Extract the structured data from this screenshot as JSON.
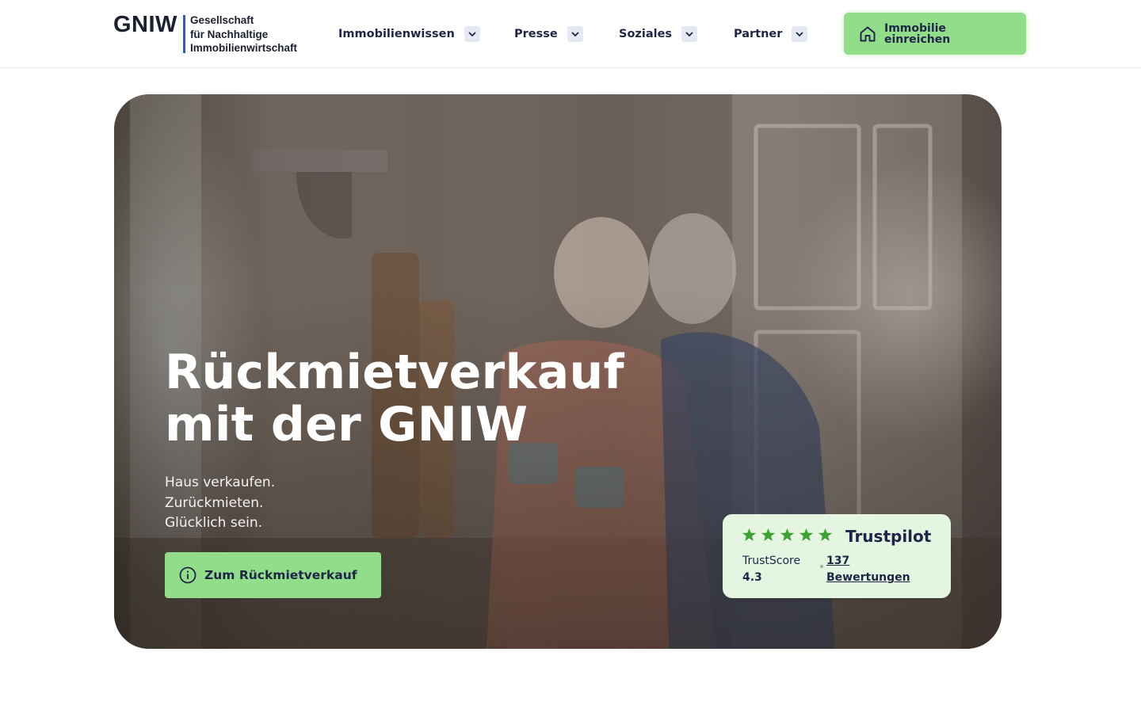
{
  "header": {
    "logo": {
      "mark": "GNIW",
      "line1": "Gesellschaft",
      "line2": "für Nachhaltige",
      "line3": "Immobilienwirtschaft"
    },
    "nav": [
      {
        "label": "Immobilienwissen"
      },
      {
        "label": "Presse"
      },
      {
        "label": "Soziales"
      },
      {
        "label": "Partner"
      }
    ],
    "cta": {
      "line1": "Immobilie",
      "line2": "einreichen",
      "icon": "home-icon"
    }
  },
  "hero": {
    "title_line1": "Rückmietverkauf",
    "title_line2": "mit der GNIW",
    "sub_line1": "Haus verkaufen.",
    "sub_line2": "Zurückmieten.",
    "sub_line3": "Glücklich sein.",
    "button": {
      "label": "Zum Rückmietverkauf",
      "icon": "info-icon"
    }
  },
  "trustpilot": {
    "brand": "Trustpilot",
    "stars": 5,
    "score_label": "TrustScore",
    "score_value": "4.3",
    "reviews_count": "137",
    "reviews_label": "Bewertungen"
  },
  "colors": {
    "accent": "#92dd8a",
    "text": "#1f2547",
    "star": "#3ba332",
    "trust_bg": "#e4f6e1",
    "chevron_bg": "#e4e9f4",
    "logo_bar": "#2a5ad6"
  }
}
